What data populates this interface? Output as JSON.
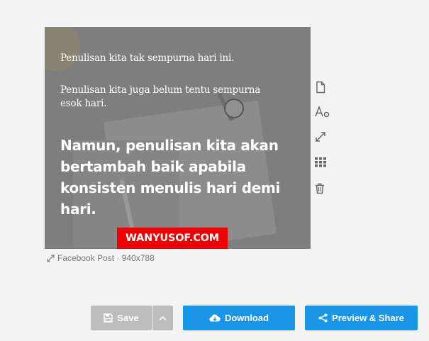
{
  "design": {
    "line1": "Penulisan kita tak sempurna hari ini.",
    "line2": "Penulisan kita juga belum tentu sempurna esok hari.",
    "line3": "Namun, penulisan kita akan bertambah baik apabila konsisten menulis hari demi hari.",
    "brand_label": "WANYUSOF.COM",
    "brand_color": "#ee0000"
  },
  "side_tools": [
    "page-icon",
    "font-settings-icon",
    "resize-icon",
    "grid-icon",
    "trash-icon"
  ],
  "caption": {
    "format": "Facebook Post",
    "separator": "·",
    "size": "940x788"
  },
  "actions": {
    "save_label": "Save",
    "download_label": "Download",
    "share_label": "Preview & Share",
    "primary_color": "#1a96e8",
    "disabled_color": "#bdbdbd"
  }
}
